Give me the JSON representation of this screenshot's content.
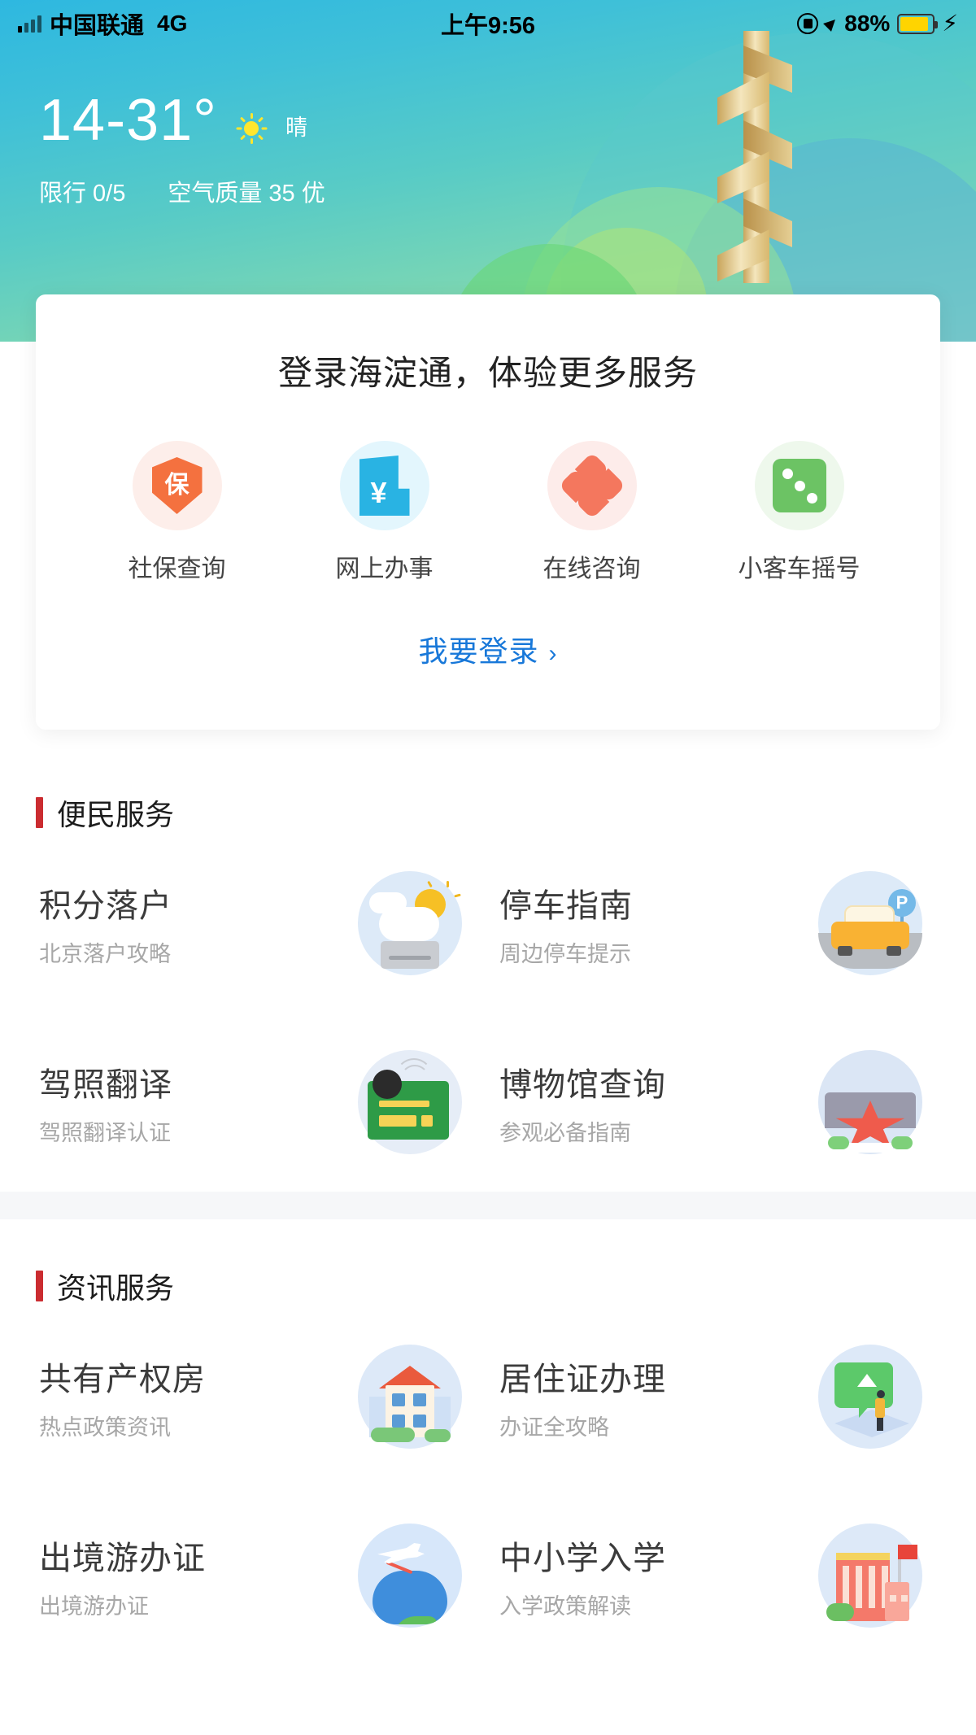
{
  "status_bar": {
    "carrier": "中国联通",
    "network": "4G",
    "time": "上午9:56",
    "battery_percent": "88%",
    "icons": [
      "signal-bars-icon",
      "rotation-lock-icon",
      "location-arrow-icon",
      "battery-icon",
      "charging-bolt-icon"
    ]
  },
  "weather": {
    "temperature_range": "14-31°",
    "condition": "晴",
    "condition_icon": "sun-icon",
    "traffic_restriction": "限行 0/5",
    "air_quality": "空气质量 35  优"
  },
  "login_card": {
    "title": "登录海淀通，体验更多服务",
    "shortcuts": [
      {
        "label": "社保查询",
        "icon": "social-security-shield-icon",
        "color": "#f4713f",
        "bg": "#fdeeea"
      },
      {
        "label": "网上办事",
        "icon": "online-service-yuan-icon",
        "color": "#29b3e3",
        "bg": "#e3f6fd"
      },
      {
        "label": "在线咨询",
        "icon": "online-consult-clover-icon",
        "color": "#f4775e",
        "bg": "#fdecea"
      },
      {
        "label": "小客车摇号",
        "icon": "car-lottery-dice-icon",
        "color": "#6cc364",
        "bg": "#eef8ec"
      }
    ],
    "login_link": "我要登录",
    "login_link_arrow": "›",
    "login_link_color": "#1878d9"
  },
  "sections": [
    {
      "title": "便民服务",
      "accent": "#cb2c30",
      "items": [
        {
          "title": "积分落户",
          "sub": "北京落户攻略",
          "icon": "points-settlement-icon"
        },
        {
          "title": "停车指南",
          "sub": "周边停车提示",
          "icon": "parking-guide-icon"
        },
        {
          "title": "驾照翻译",
          "sub": "驾照翻译认证",
          "icon": "license-translation-icon"
        },
        {
          "title": "博物馆查询",
          "sub": "参观必备指南",
          "icon": "museum-query-icon"
        }
      ]
    },
    {
      "title": "资讯服务",
      "accent": "#cb2c30",
      "items": [
        {
          "title": "共有产权房",
          "sub": "热点政策资讯",
          "icon": "shared-ownership-house-icon"
        },
        {
          "title": "居住证办理",
          "sub": "办证全攻略",
          "icon": "residence-permit-icon"
        },
        {
          "title": "出境游办证",
          "sub": "出境游办证",
          "icon": "outbound-travel-icon"
        },
        {
          "title": "中小学入学",
          "sub": "入学政策解读",
          "icon": "school-enrollment-icon"
        }
      ]
    }
  ]
}
